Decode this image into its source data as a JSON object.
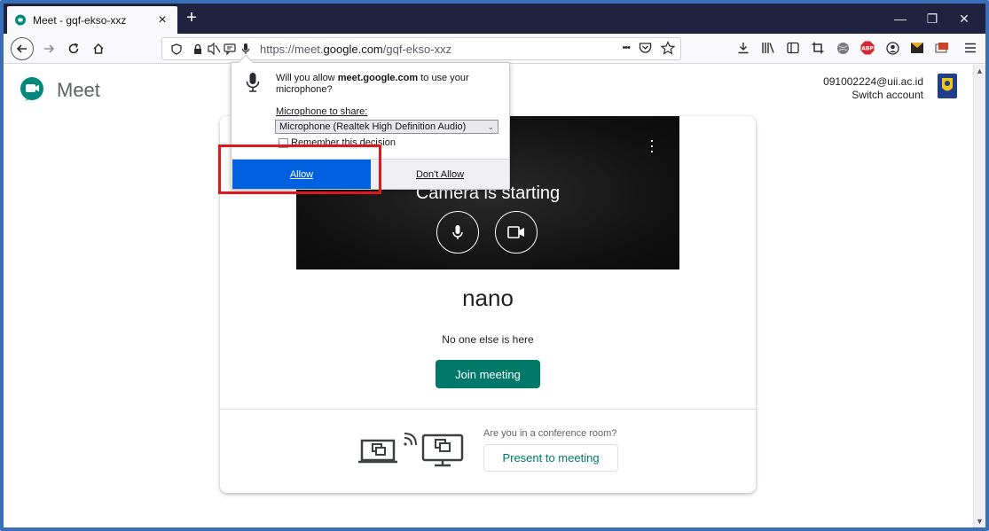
{
  "browser": {
    "tab_title": "Meet - gqf-ekso-xxz",
    "tab_close": "×",
    "new_tab": "+",
    "win_minimize": "—",
    "win_restore": "❐",
    "win_close": "✕",
    "url_prefix": "https://meet.",
    "url_domain": "google.com",
    "url_path": "/gqf-ekso-xxz",
    "more_actions": "•••"
  },
  "permission": {
    "question_pre": "Will you allow ",
    "question_host": "meet.google.com",
    "question_post": " to use your microphone?",
    "share_label": "Microphone to share:",
    "selected_device": "Microphone (Realtek High Definition Audio)",
    "remember_label": "Remember this decision",
    "allow_label": "Allow",
    "dont_allow_label": "Don't Allow"
  },
  "meet": {
    "logo_text": "Meet",
    "account_email": "091002224@uii.ac.id",
    "switch_account": "Switch account",
    "camera_status": "Camera is starting",
    "meeting_name": "nano",
    "no_one_text": "No one else is here",
    "join_label": "Join meeting",
    "conference_question": "Are you in a conference room?",
    "present_label": "Present to meeting"
  },
  "colors": {
    "accent_teal": "#00796b",
    "allow_blue": "#0061e0",
    "highlight_red": "#e0181b",
    "tabbar": "#202340"
  }
}
